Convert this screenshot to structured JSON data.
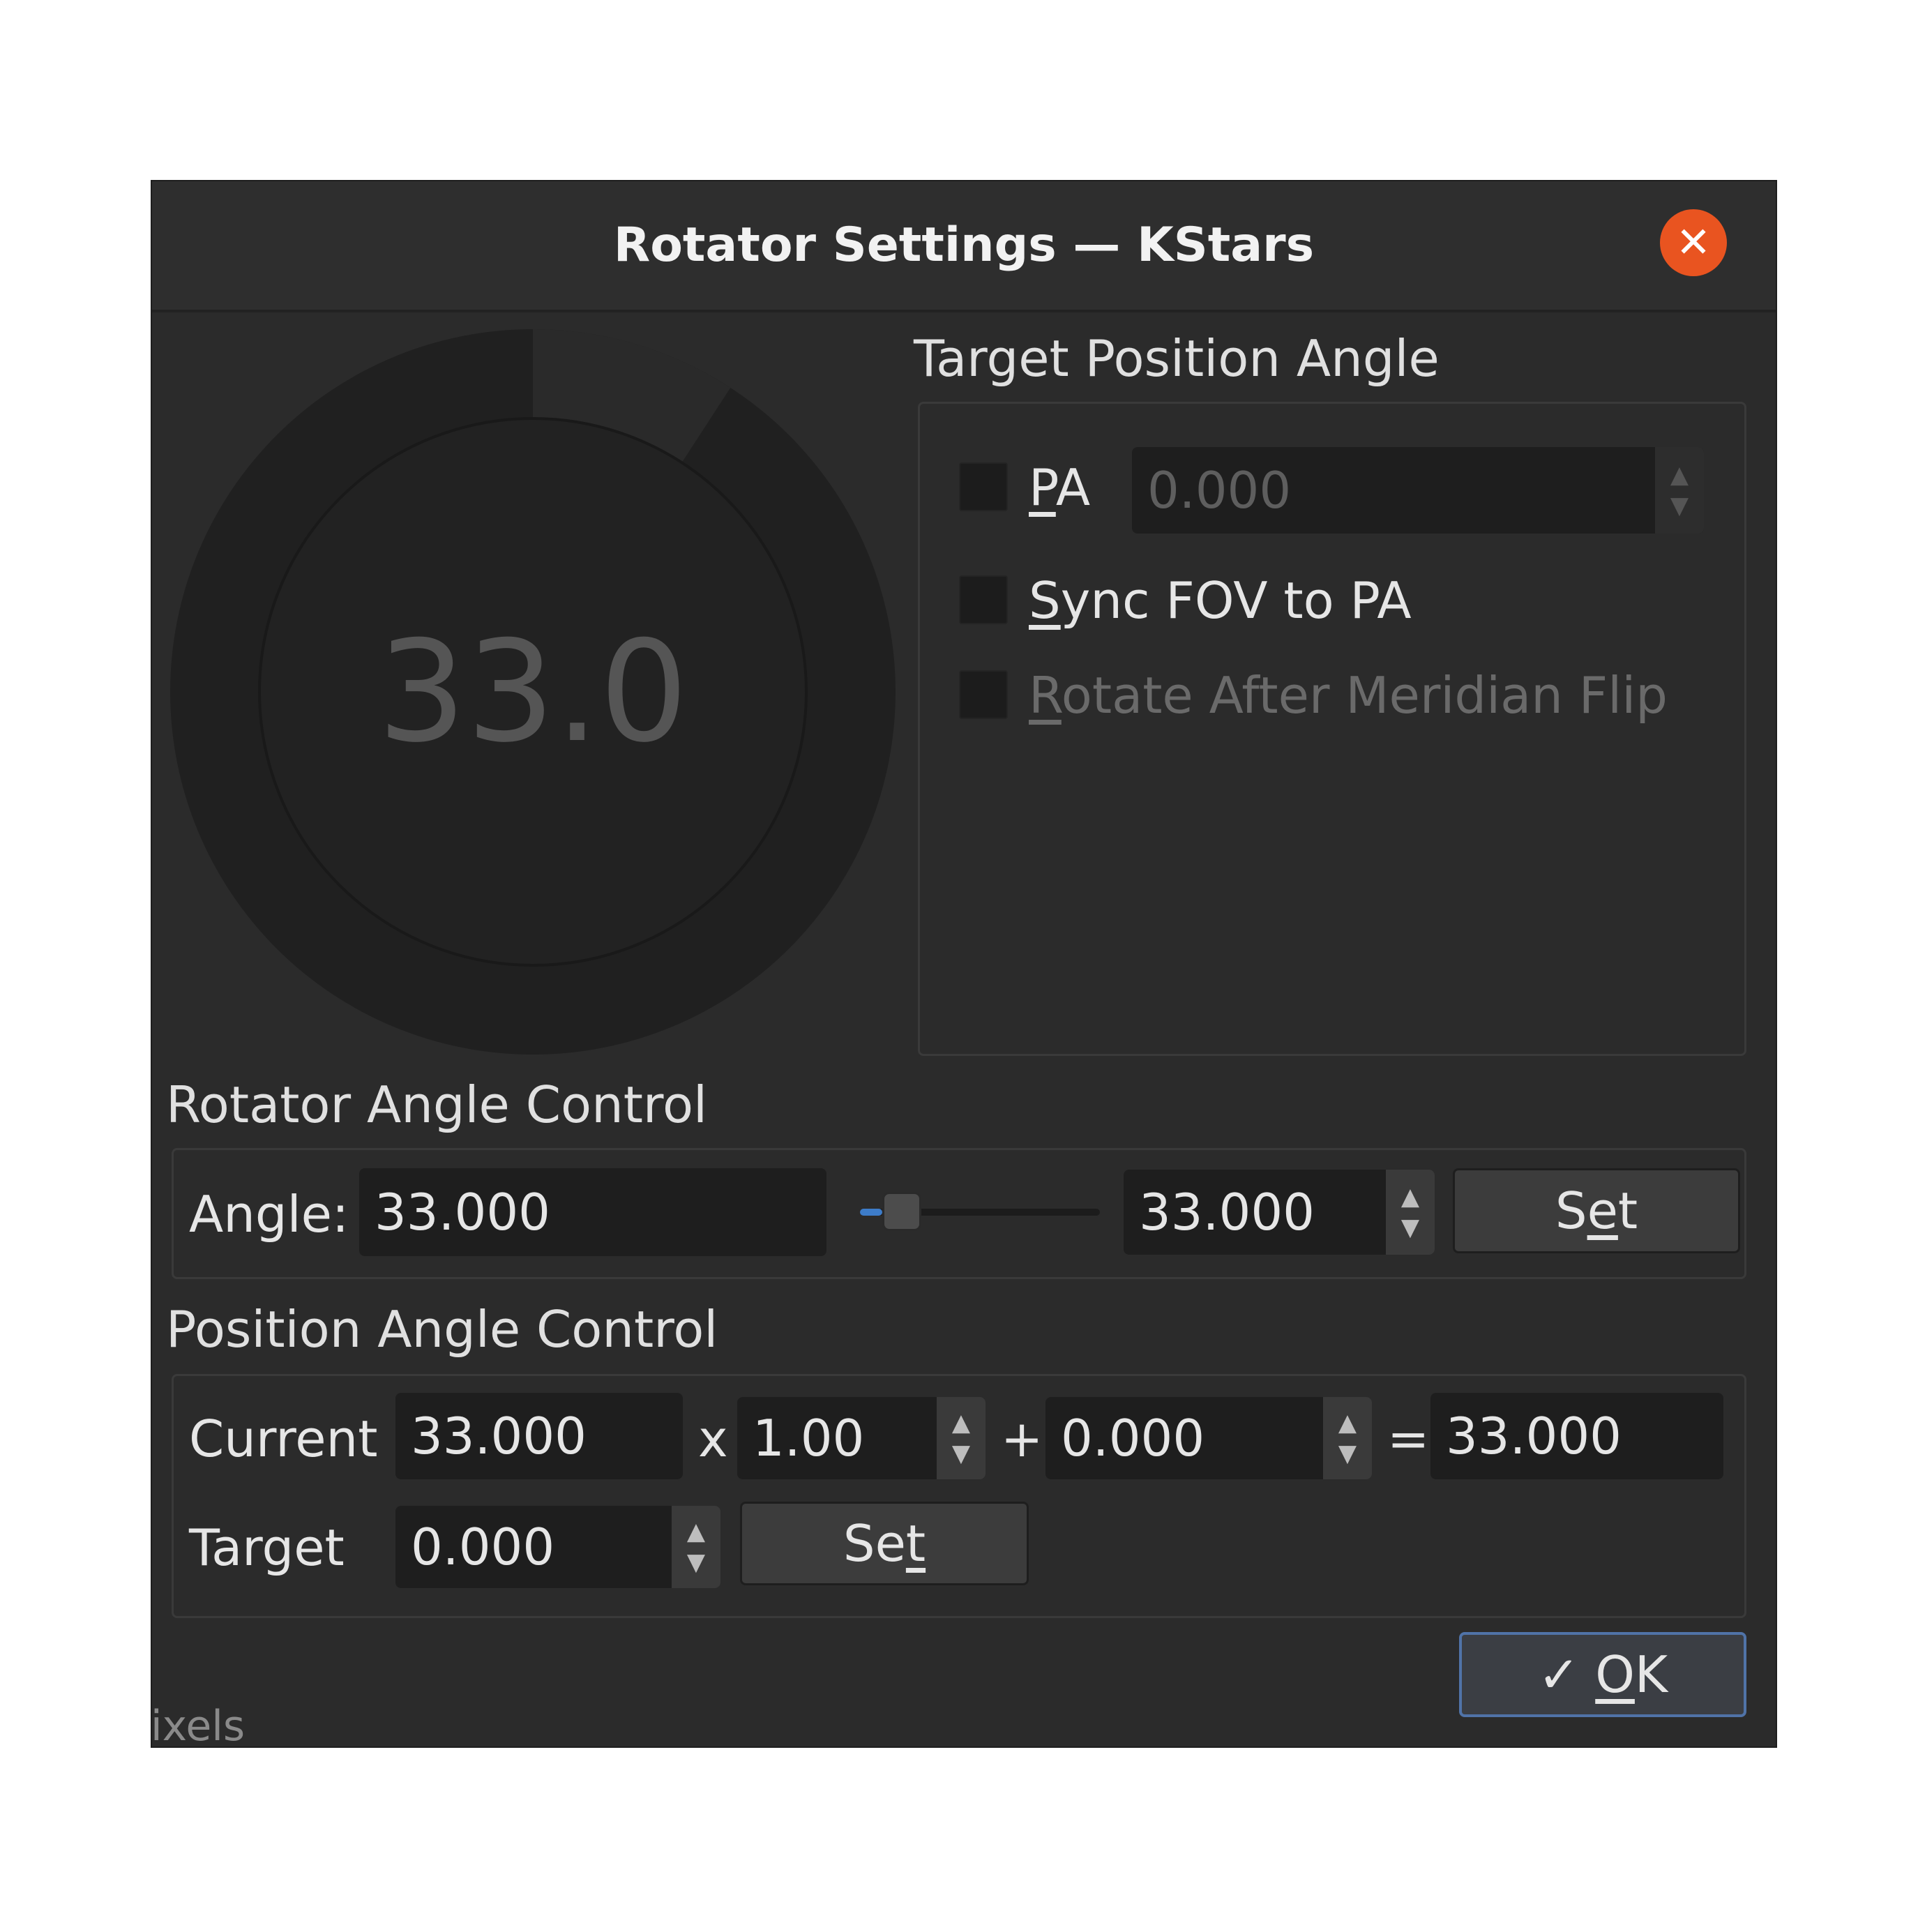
{
  "window": {
    "title": "Rotator Settings — KStars",
    "close_glyph": "✕"
  },
  "dial": {
    "value_text": "33.0",
    "angle_fraction": 0.0917
  },
  "target_pa": {
    "group_title": "Target Position Angle",
    "pa_label_u": "P",
    "pa_label_rest": "A",
    "pa_value": "0.000",
    "sync_label_u": "S",
    "sync_label_rest": "ync FOV to PA",
    "rotate_label_u": "R",
    "rotate_label_rest": "otate After Meridian Flip"
  },
  "rotator_angle": {
    "group_title": "Rotator Angle Control",
    "angle_label": "Angle:",
    "angle_value": "33.000",
    "spin_value": "33.000",
    "slider_fraction": 0.0917,
    "set_label_a": "S",
    "set_label_u": "e",
    "set_label_b": "t"
  },
  "position_angle": {
    "group_title": "Position Angle Control",
    "current_label": "Current",
    "current_value": "33.000",
    "times": "x",
    "multiplier": "1.00",
    "plus": "+",
    "offset": "0.000",
    "equals": "=",
    "result": "33.000",
    "target_label": "Target",
    "target_value": "0.000",
    "set_label_a": "Se",
    "set_label_u": "t"
  },
  "footer": {
    "ok_check": "✓",
    "ok_label_u": "O",
    "ok_label_rest": "K"
  },
  "background_fragment": "ixels",
  "icons": {
    "spin_up": "▲",
    "spin_down": "▼"
  }
}
